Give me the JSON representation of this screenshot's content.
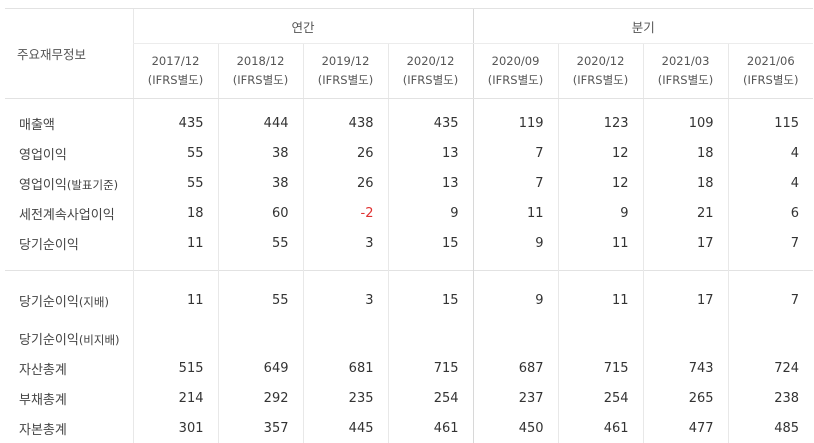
{
  "header": {
    "corner": "주요재무정보",
    "annual": "연간",
    "quarter": "분기"
  },
  "periods": [
    {
      "date": "2017/12",
      "basis": "(IFRS별도)"
    },
    {
      "date": "2018/12",
      "basis": "(IFRS별도)"
    },
    {
      "date": "2019/12",
      "basis": "(IFRS별도)"
    },
    {
      "date": "2020/12",
      "basis": "(IFRS별도)"
    },
    {
      "date": "2020/09",
      "basis": "(IFRS별도)"
    },
    {
      "date": "2020/12",
      "basis": "(IFRS별도)"
    },
    {
      "date": "2021/03",
      "basis": "(IFRS별도)"
    },
    {
      "date": "2021/06",
      "basis": "(IFRS별도)"
    }
  ],
  "rows": [
    {
      "label": "매출액",
      "values": [
        "435",
        "444",
        "438",
        "435",
        "119",
        "123",
        "109",
        "115"
      ]
    },
    {
      "label": "영업이익",
      "values": [
        "55",
        "38",
        "26",
        "13",
        "7",
        "12",
        "18",
        "4"
      ]
    },
    {
      "label": "영업이익",
      "suffix": "(발표기준)",
      "values": [
        "55",
        "38",
        "26",
        "13",
        "7",
        "12",
        "18",
        "4"
      ]
    },
    {
      "label": "세전계속사업이익",
      "values": [
        "18",
        "60",
        "-2",
        "9",
        "11",
        "9",
        "21",
        "6"
      ]
    },
    {
      "label": "당기순이익",
      "values": [
        "11",
        "55",
        "3",
        "15",
        "9",
        "11",
        "17",
        "7"
      ]
    },
    {
      "label": "당기순이익",
      "suffix": "(지배)",
      "values": [
        "11",
        "55",
        "3",
        "15",
        "9",
        "11",
        "17",
        "7"
      ]
    },
    {
      "label": "당기순이익",
      "suffix": "(비지배)",
      "values": [
        "",
        "",
        "",
        "",
        "",
        "",
        "",
        ""
      ]
    },
    {
      "label": "자산총계",
      "values": [
        "515",
        "649",
        "681",
        "715",
        "687",
        "715",
        "743",
        "724"
      ]
    },
    {
      "label": "부채총계",
      "values": [
        "214",
        "292",
        "235",
        "254",
        "237",
        "254",
        "265",
        "238"
      ]
    },
    {
      "label": "자본총계",
      "values": [
        "301",
        "357",
        "445",
        "461",
        "450",
        "461",
        "477",
        "485"
      ]
    }
  ],
  "colors": {
    "negative": "#e03131",
    "text": "#333333",
    "border": "#e2e2e2"
  }
}
